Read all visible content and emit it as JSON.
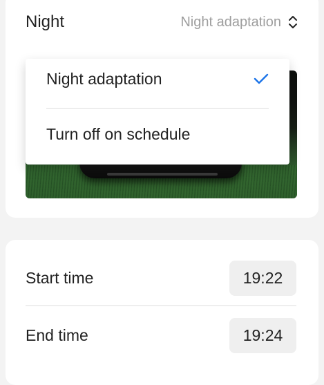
{
  "night_section": {
    "label": "Night",
    "selected_mode": "Night adaptation",
    "menu": {
      "items": [
        {
          "label": "Night adaptation",
          "selected": true
        },
        {
          "label": "Turn off on schedule",
          "selected": false
        }
      ]
    }
  },
  "schedule": {
    "start": {
      "label": "Start time",
      "value": "19:22"
    },
    "end": {
      "label": "End time",
      "value": "19:24"
    }
  },
  "colors": {
    "accent": "#1a73e8",
    "muted_text": "#9e9e9e",
    "background": "#f3f3f3",
    "card": "#ffffff"
  },
  "icons": {
    "mode_select": "chevron-updown-icon",
    "selected_item": "check-icon"
  }
}
